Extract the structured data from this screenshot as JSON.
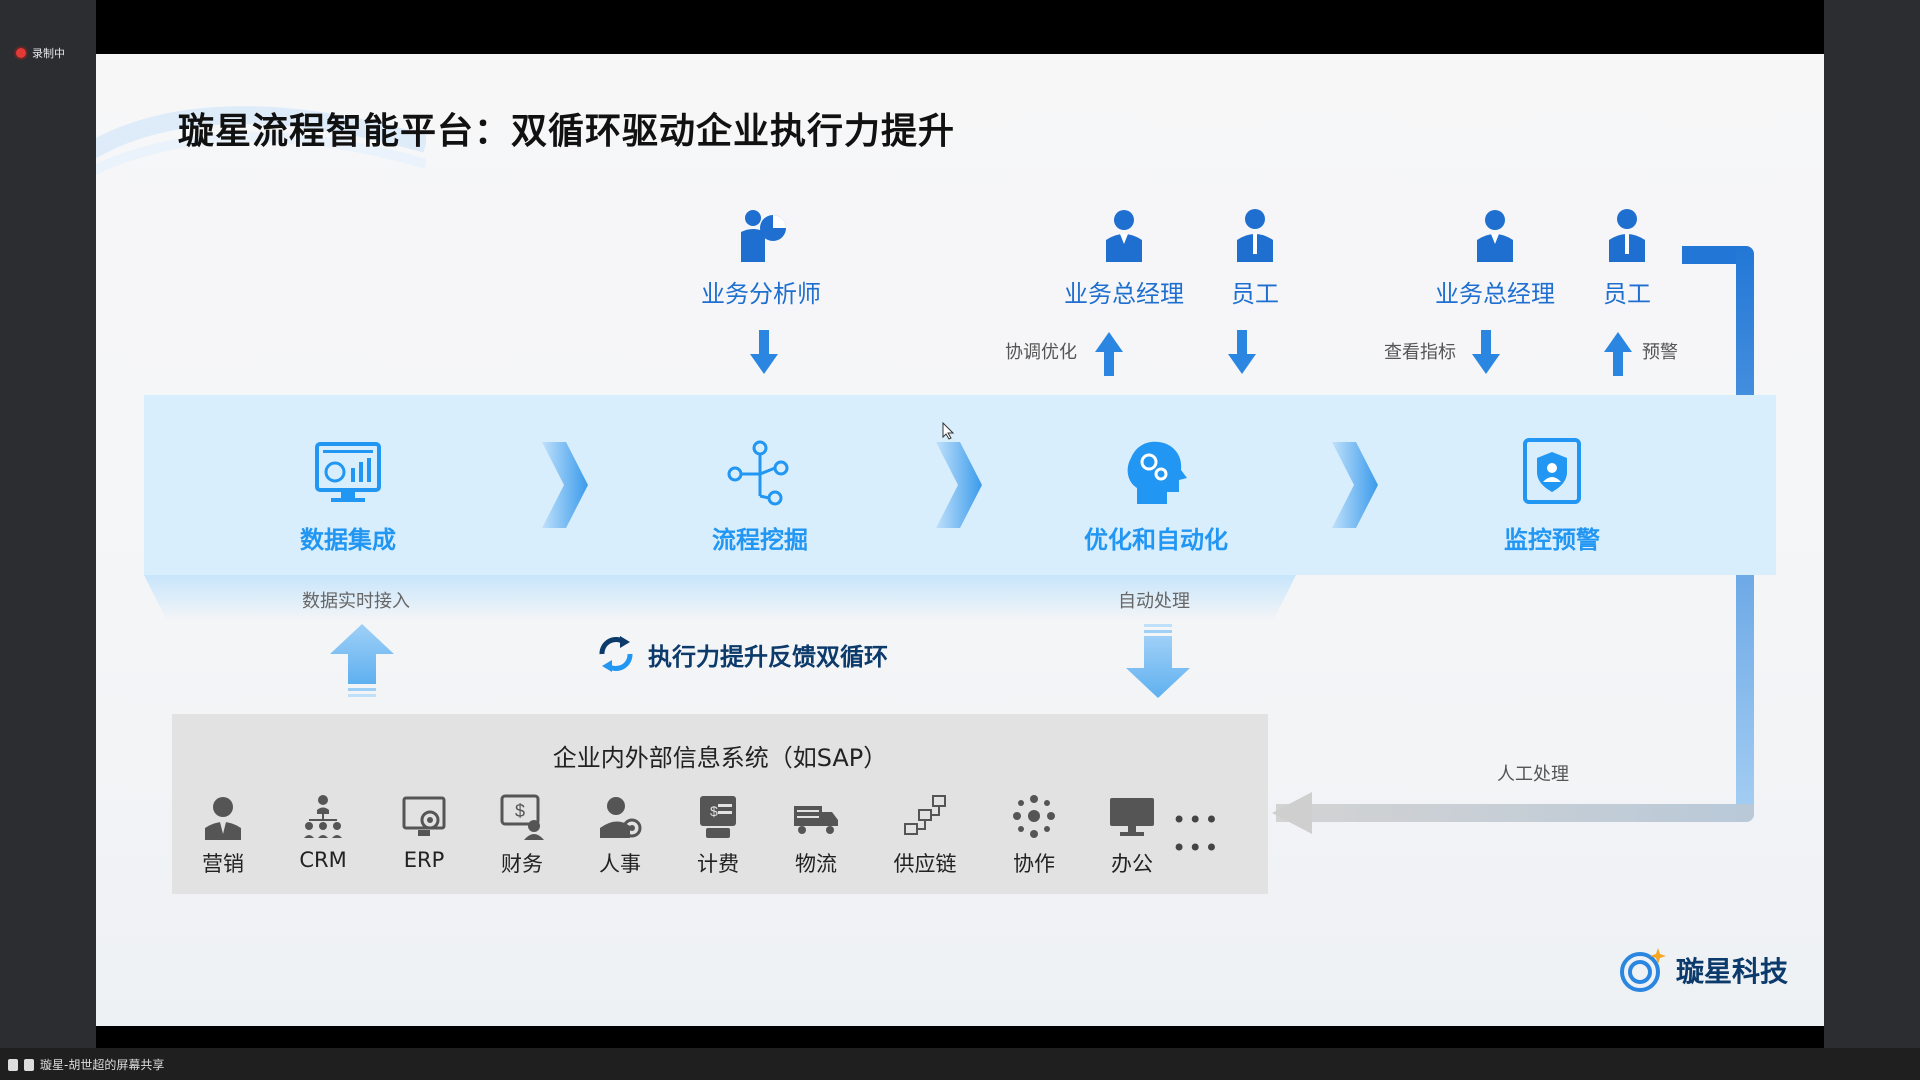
{
  "recording": {
    "label": "录制中"
  },
  "screen_share": {
    "label": "璇星-胡世超的屏幕共享"
  },
  "slide": {
    "title": "璇星流程智能平台：双循环驱动企业执行力提升",
    "roles": [
      {
        "label": "业务分析师",
        "icon": "analyst-icon"
      },
      {
        "label": "业务总经理",
        "icon": "manager-icon"
      },
      {
        "label": "员工",
        "icon": "employee-icon"
      },
      {
        "label": "业务总经理",
        "icon": "manager-icon"
      },
      {
        "label": "员工",
        "icon": "employee-icon"
      }
    ],
    "annotations": {
      "coordinate": "协调优化",
      "view_metrics": "查看指标",
      "warning": "预警",
      "data_realtime": "数据实时接入",
      "auto_process": "自动处理",
      "manual_process": "人工处理"
    },
    "stages": [
      {
        "label": "数据集成",
        "icon": "data-integration-icon"
      },
      {
        "label": "流程挖掘",
        "icon": "process-mining-icon"
      },
      {
        "label": "优化和自动化",
        "icon": "optimize-automation-icon"
      },
      {
        "label": "监控预警",
        "icon": "monitor-alert-icon"
      }
    ],
    "feedback_loop": {
      "label": "执行力提升反馈双循环"
    },
    "systems": {
      "title": "企业内外部信息系统（如SAP）",
      "items": [
        {
          "label": "营销",
          "icon": "marketing-icon"
        },
        {
          "label": "CRM",
          "icon": "crm-icon"
        },
        {
          "label": "ERP",
          "icon": "erp-icon"
        },
        {
          "label": "财务",
          "icon": "finance-icon"
        },
        {
          "label": "人事",
          "icon": "hr-icon"
        },
        {
          "label": "计费",
          "icon": "billing-icon"
        },
        {
          "label": "物流",
          "icon": "logistics-icon"
        },
        {
          "label": "供应链",
          "icon": "supply-chain-icon"
        },
        {
          "label": "协作",
          "icon": "collaboration-icon"
        },
        {
          "label": "办公",
          "icon": "office-icon"
        }
      ],
      "more": "•••  •••"
    },
    "brand": {
      "name": "璇星科技"
    }
  },
  "colors": {
    "primary_blue": "#2196f3",
    "dark_blue": "#0b3a6b",
    "band": "#d9eefc"
  }
}
